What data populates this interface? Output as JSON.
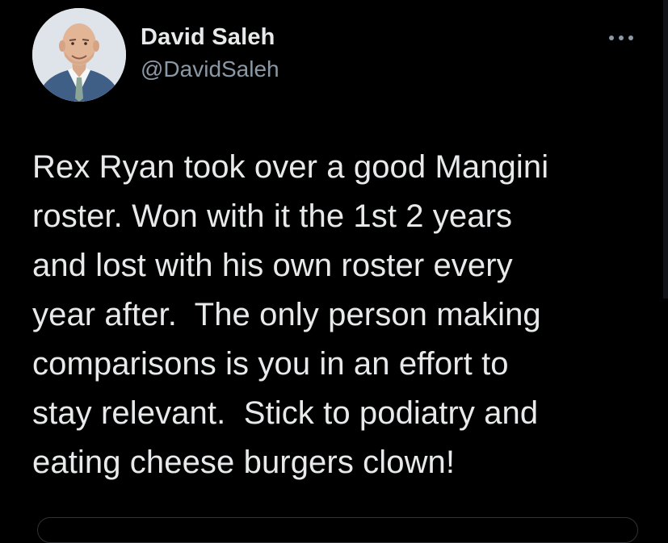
{
  "tweet": {
    "author": {
      "display_name": "David Saleh",
      "handle": "@DavidSaleh",
      "avatar": "profile-photo-man-in-suit"
    },
    "more_icon": "more-dots-icon",
    "text_lines": [
      "Rex Ryan took over a good Mangini",
      "roster. Won with it the 1st 2 years",
      "and lost with his own roster every",
      "year after.  The only person making",
      "comparisons is you in an effort to",
      "stay relevant.  Stick to podiatry and",
      "eating cheese burgers clown!"
    ]
  },
  "colors": {
    "background": "#000000",
    "primary_text": "#e7e9ea",
    "secondary_text": "#8b98a5",
    "border": "#2f3336"
  }
}
